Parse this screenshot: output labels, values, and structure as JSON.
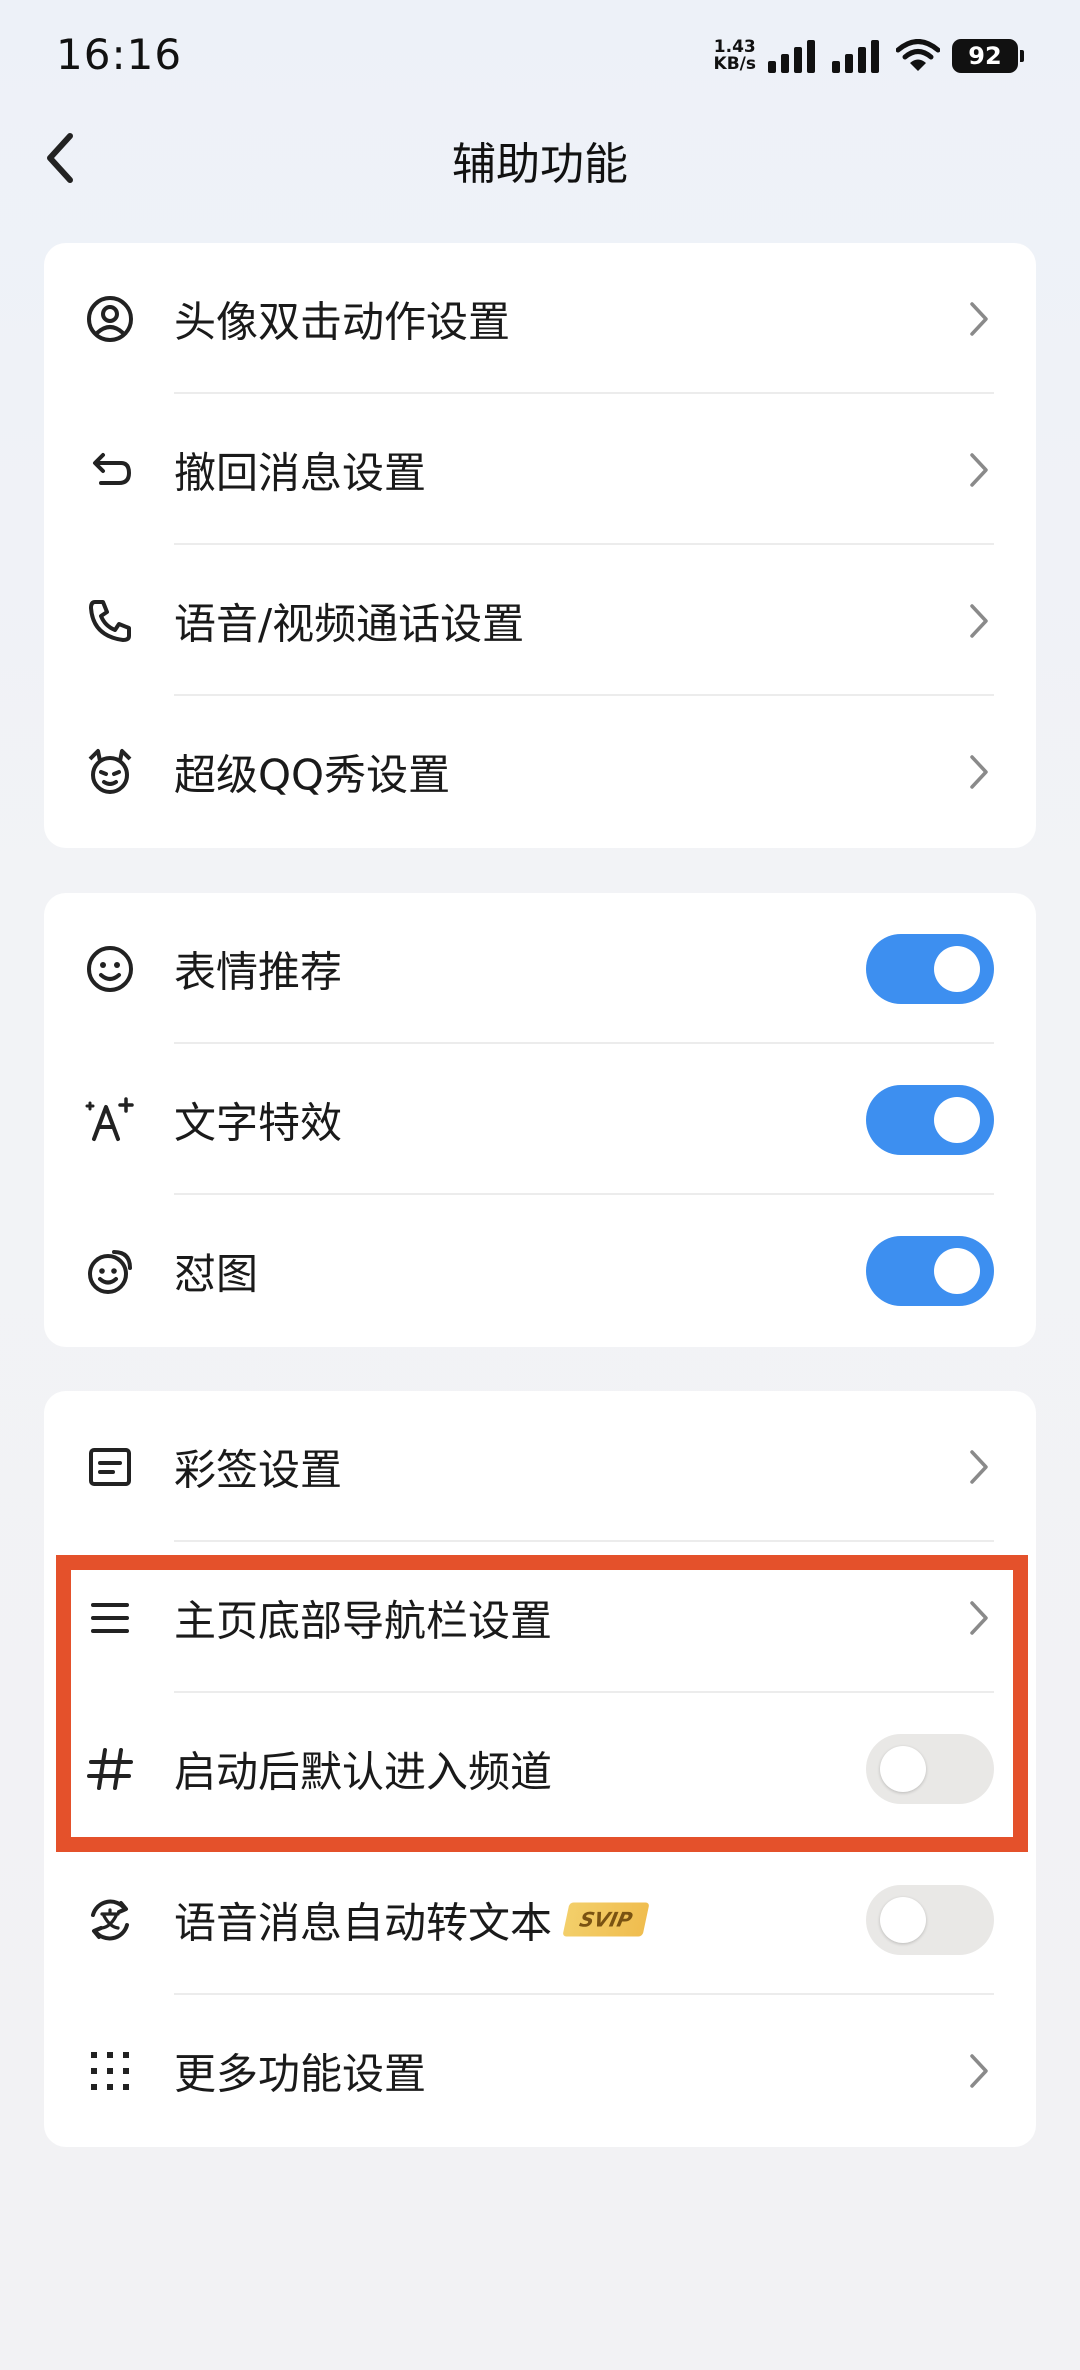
{
  "status_bar": {
    "time": "16:16",
    "net_speed_value": "1.43",
    "net_speed_unit": "KB/s",
    "battery": "92"
  },
  "header": {
    "title": "辅助功能",
    "back_icon": "chevron-left-icon"
  },
  "groups": [
    {
      "items": [
        {
          "label": "头像双击动作设置",
          "icon": "avatar-circle-icon",
          "control": "chevron"
        },
        {
          "label": "撤回消息设置",
          "icon": "undo-arrow-icon",
          "control": "chevron"
        },
        {
          "label": "语音/视频通话设置",
          "icon": "phone-icon",
          "control": "chevron"
        },
        {
          "label": "超级QQ秀设置",
          "icon": "qq-show-face-icon",
          "control": "chevron"
        }
      ]
    },
    {
      "items": [
        {
          "label": "表情推荐",
          "icon": "smiley-icon",
          "control": "toggle",
          "checked": true
        },
        {
          "label": "文字特效",
          "icon": "text-sparkle-icon",
          "control": "toggle",
          "checked": true
        },
        {
          "label": "怼图",
          "icon": "swirl-smiley-icon",
          "control": "toggle",
          "checked": true
        }
      ]
    },
    {
      "items": [
        {
          "label": "彩签设置",
          "icon": "note-card-icon",
          "control": "chevron"
        },
        {
          "label": "主页底部导航栏设置",
          "icon": "menu-lines-icon",
          "control": "chevron"
        },
        {
          "label": "启动后默认进入频道",
          "icon": "hashtag-icon",
          "control": "toggle",
          "checked": false
        },
        {
          "label": "语音消息自动转文本",
          "badge": "SVIP",
          "icon": "voice-to-text-icon",
          "control": "toggle",
          "checked": false
        },
        {
          "label": "更多功能设置",
          "icon": "grid-dots-icon",
          "control": "chevron"
        }
      ]
    }
  ],
  "colors": {
    "toggle_on": "#3d8ff0",
    "toggle_off": "#e9e8e6",
    "highlight": "#e4512b"
  }
}
